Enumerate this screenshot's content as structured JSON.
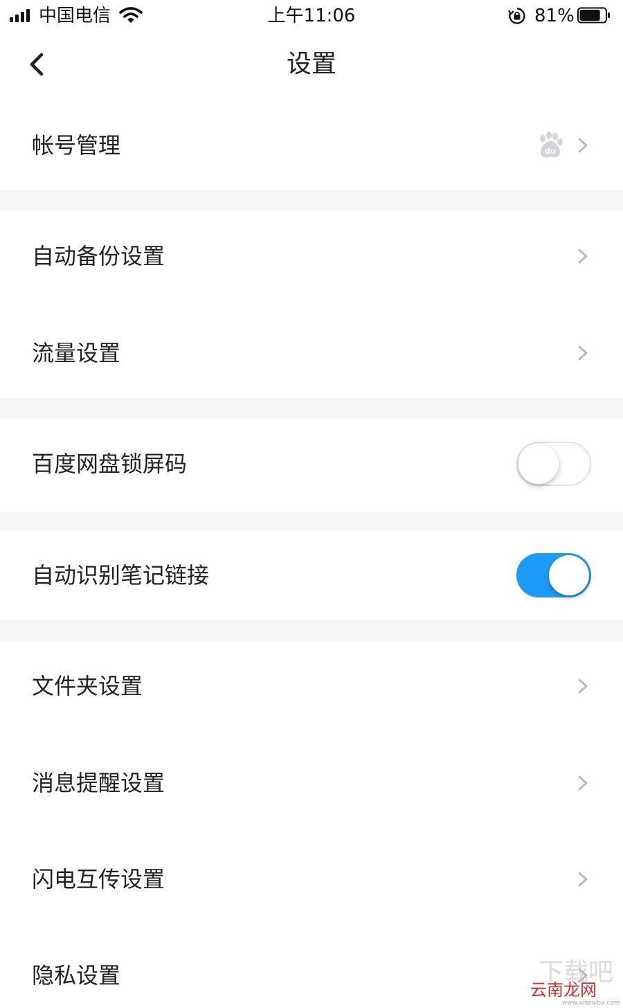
{
  "status_bar": {
    "carrier": "中国电信",
    "time": "上午11:06",
    "battery_percent": "81%",
    "battery_level": 0.81
  },
  "header": {
    "title": "设置",
    "back_icon": "chevron-left-icon"
  },
  "settings": {
    "account": {
      "label": "帐号管理",
      "icon": "baidu-paw-icon"
    },
    "auto_backup": {
      "label": "自动备份设置"
    },
    "data_usage": {
      "label": "流量设置"
    },
    "lock_screen": {
      "label": "百度网盘锁屏码",
      "enabled": false
    },
    "note_links": {
      "label": "自动识别笔记链接",
      "enabled": true
    },
    "folder": {
      "label": "文件夹设置"
    },
    "notifications": {
      "label": "消息提醒设置"
    },
    "flash_transfer": {
      "label": "闪电互传设置"
    },
    "privacy": {
      "label": "隐私设置"
    }
  },
  "watermark": {
    "main": "下载吧",
    "overlay": "云南龙网",
    "url": "www.xiazaiba.com"
  },
  "colors": {
    "accent": "#1e9bf5",
    "section_gap": "#f6f6f8",
    "text": "#222222",
    "chevron": "#b9b9be",
    "watermark_red": "#d0312d"
  }
}
